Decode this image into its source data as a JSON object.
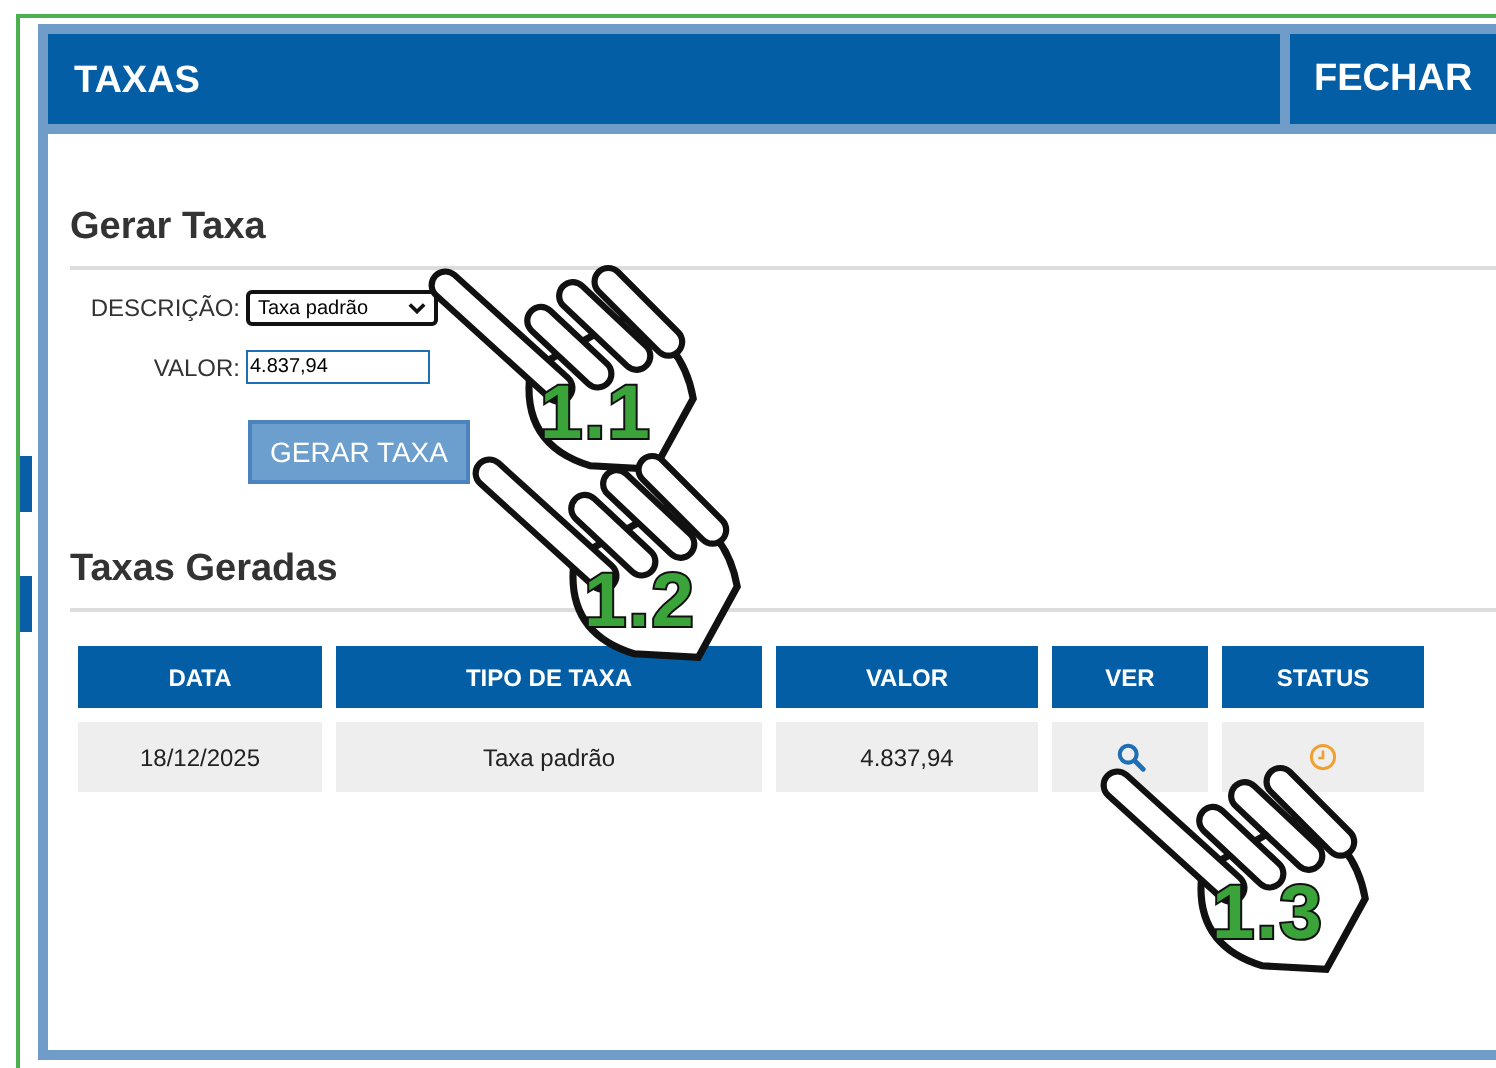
{
  "window": {
    "title": "TAXAS",
    "close_button": "FECHAR"
  },
  "form": {
    "title": "Gerar Taxa",
    "fields": [
      {
        "kind": "select",
        "label": "DESCRIÇÃO:",
        "value": "Taxa padrão"
      },
      {
        "kind": "text",
        "label": "VALOR:",
        "value": "4.837,94"
      }
    ],
    "button": "GERAR TAXA"
  },
  "table": {
    "title": "Taxas Geradas",
    "columns": [
      "DATA",
      "TIPO DE TAXA",
      "VALOR",
      "VER",
      "STATUS"
    ],
    "rows": [
      {
        "cells": [
          "18/12/2025",
          "Taxa padrão",
          "4.837,94"
        ]
      }
    ]
  },
  "annotations": [
    {
      "label": "1.1"
    },
    {
      "label": "1.2"
    },
    {
      "label": "1.3"
    }
  ]
}
